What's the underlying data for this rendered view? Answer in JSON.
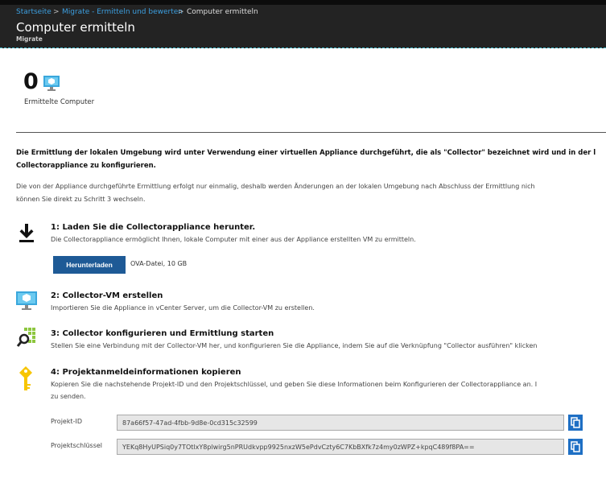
{
  "breadcrumb": {
    "home": "Startseite",
    "parent": "Migrate - Ermitteln und bewerten",
    "current": "Computer ermitteln",
    "separator": ">"
  },
  "header": {
    "title": "Computer ermitteln",
    "subtitle": "Migrate"
  },
  "summary": {
    "count": "0",
    "label": "Ermittelte Computer"
  },
  "intro": {
    "bold_line1": "Die Ermittlung der lokalen Umgebung wird unter Verwendung einer virtuellen Appliance durchgeführt, die als \"Collector\" bezeichnet wird und in der l",
    "bold_line2": "Collectorappliance zu konfigurieren.",
    "line1": "Die von der Appliance durchgeführte Ermittlung erfolgt nur einmalig, deshalb werden Änderungen an der lokalen Umgebung nach Abschluss der Ermittlung nich",
    "line2": "können Sie direkt zu Schritt 3 wechseln."
  },
  "steps": [
    {
      "title": "1: Laden Sie die Collectorappliance herunter.",
      "desc": "Die Collectorappliance ermöglicht Ihnen, lokale Computer mit einer aus der Appliance erstellten VM zu ermitteln.",
      "icon": "download-icon"
    },
    {
      "title": "2: Collector-VM erstellen",
      "desc": "Importieren Sie die Appliance in vCenter Server, um die Collector-VM zu erstellen.",
      "icon": "monitor-icon"
    },
    {
      "title": "3: Collector konfigurieren und Ermittlung starten",
      "desc": "Stellen Sie eine Verbindung mit der Collector-VM her, und konfigurieren Sie die Appliance, indem Sie auf die Verknüpfung \"Collector ausführen\" klicken",
      "icon": "search-grid-icon"
    },
    {
      "title": "4: Projektanmeldeinformationen kopieren",
      "desc": "Kopieren Sie die nachstehende Projekt-ID und den Projektschlüssel, und geben Sie diese Informationen beim Konfigurieren der Collectorappliance an. I",
      "desc2": "zu senden.",
      "icon": "key-icon"
    }
  ],
  "download": {
    "button": "Herunterladen",
    "info": "OVA-Datei, 10 GB"
  },
  "fields": {
    "project_id_label": "Projekt-ID",
    "project_id": "87a66f57-47ad-4fbb-9d8e-0cd315c32599",
    "project_key_label": "Projektschlüssel",
    "project_key": "YEKq8HyUPSiq0y7TOtlxY8plwirg5nPRUdkvpp9925nxzW5ePdvCzty6C7KbBXfk7z4my0zWPZ+kpqC489f8PA=="
  },
  "colors": {
    "accent": "#1e5a96",
    "link": "#3c9fe0",
    "header": "#232323"
  }
}
